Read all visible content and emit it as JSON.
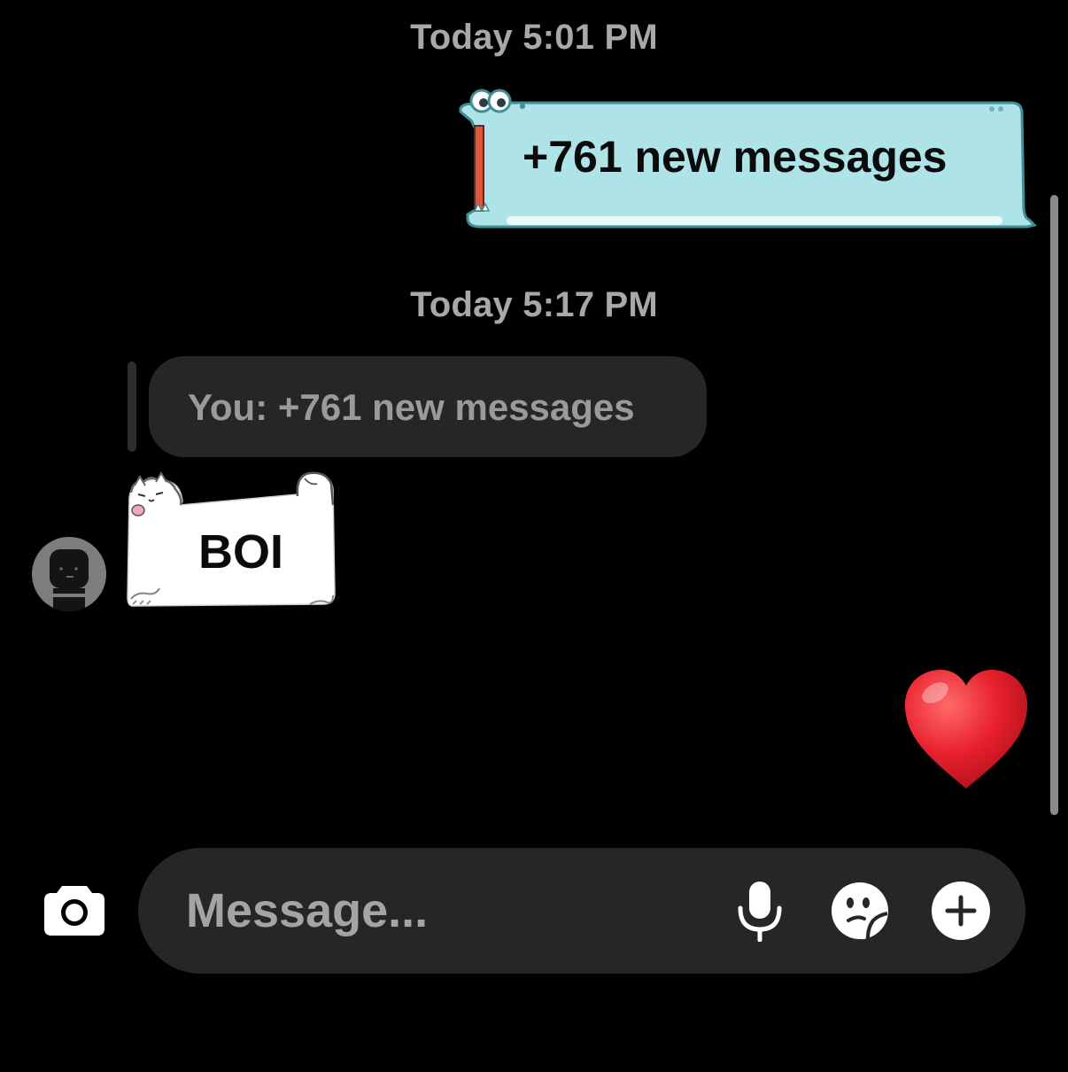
{
  "thread": {
    "timestamps": [
      "Today 5:01 PM",
      "Today 5:17 PM"
    ],
    "sent_message": "+761 new messages",
    "reply_preview": "You: +761 new messages",
    "received_message": "BOI",
    "reaction_emoji": "heart"
  },
  "composer": {
    "placeholder": "Message..."
  },
  "icons": {
    "camera": "camera-icon",
    "mic": "microphone-icon",
    "sticker": "sticker-icon",
    "plus": "plus-icon"
  },
  "colors": {
    "background": "#000000",
    "sent_bubble": "#aee3e8",
    "sent_bubble_border": "#3f8f96",
    "received_bubble": "#ffffff",
    "reply_preview_bg": "#262626",
    "composer_bg": "#262626",
    "timestamp_text": "#a8a8a8",
    "heart": "#e8202d"
  }
}
